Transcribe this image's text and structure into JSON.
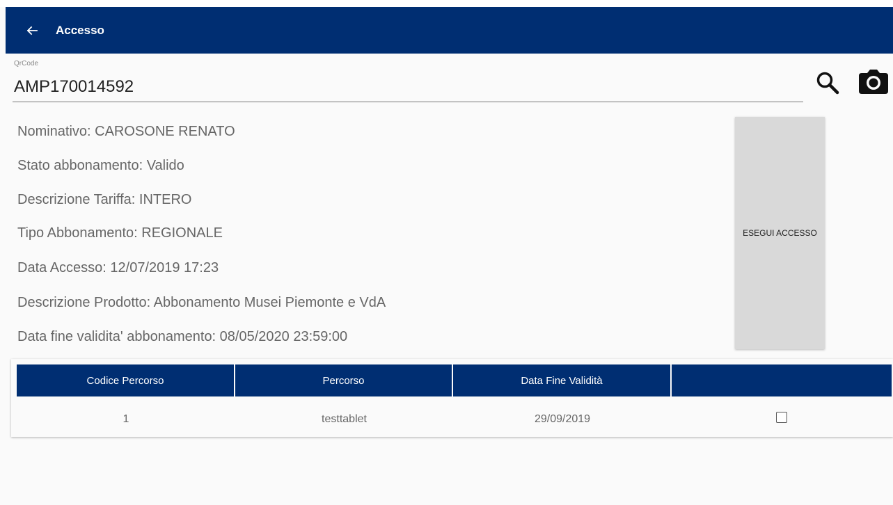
{
  "appbar": {
    "back_icon": "arrow-left-icon",
    "title": "Accesso"
  },
  "qrcode": {
    "label": "QrCode",
    "value": "AMP170014592"
  },
  "actions": {
    "search_icon": "search-icon",
    "camera_icon": "camera-icon"
  },
  "info": {
    "nominativo": "Nominativo: CAROSONE RENATO",
    "stato": "Stato abbonamento: Valido",
    "tariffa": "Descrizione Tariffa: INTERO",
    "tipo": "Tipo Abbonamento: REGIONALE",
    "data_accesso": "Data Accesso: 12/07/2019 17:23",
    "prodotto": "Descrizione Prodotto: Abbonamento Musei Piemonte e VdA",
    "fine_validita": "Data fine validita' abbonamento: 08/05/2020 23:59:00"
  },
  "exec_button": {
    "label": "ESEGUI ACCESSO"
  },
  "table": {
    "headers": [
      "Codice Percorso",
      "Percorso",
      "Data Fine Validità",
      ""
    ],
    "rows": [
      {
        "codice": "1",
        "percorso": "testtablet",
        "data_fine": "29/09/2019",
        "checked": false
      }
    ]
  },
  "colors": {
    "primary": "#002e72",
    "button_bg": "#d9d9d9",
    "background": "#fafafa"
  }
}
